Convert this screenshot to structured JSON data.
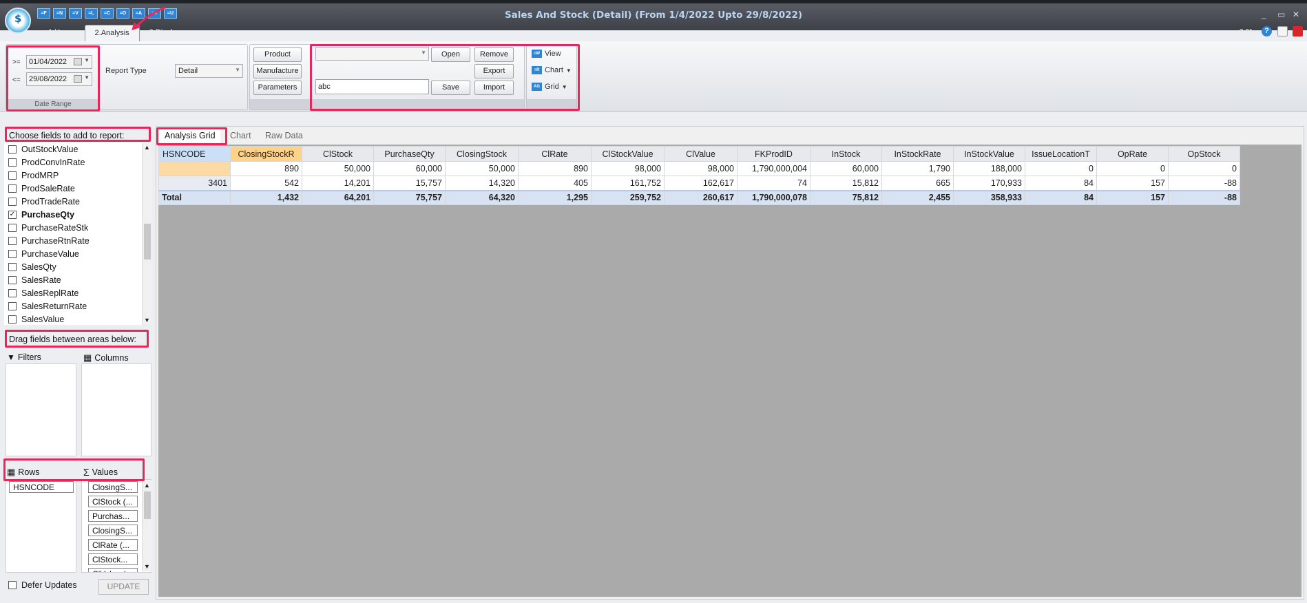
{
  "window": {
    "title": "Sales And Stock (Detail)  (From 1/4/2022 Upto 29/8/2022)",
    "version": "3.31",
    "logo_text": "$",
    "qat_buttons": [
      "=F",
      "=N",
      "=V",
      "=L",
      "=C",
      "=O",
      "=A",
      "=T",
      "=U"
    ],
    "controls": [
      "_",
      "▭",
      "✕"
    ]
  },
  "tabs": [
    {
      "label": "1.Home"
    },
    {
      "label": "2.Analysis"
    },
    {
      "label": "3.Display"
    }
  ],
  "ribbon": {
    "date_range": {
      "from_op": ">=",
      "from_value": "01/04/2022",
      "to_op": "<=",
      "to_value": "29/08/2022",
      "group_label": "Date Range"
    },
    "report_type": {
      "label": "Report Type",
      "value": "Detail"
    },
    "filter_buttons": [
      "Product",
      "Manufacture",
      "Parameters"
    ],
    "layout": {
      "combo_value": "",
      "name_value": "abc",
      "open_label": "Open",
      "remove_label": "Remove",
      "export_label": "Export",
      "save_label": "Save",
      "import_label": "Import"
    },
    "view_buttons": [
      {
        "label": "View",
        "icon": "view-icon"
      },
      {
        "label": "Chart",
        "icon": "chart-icon"
      },
      {
        "label": "Grid",
        "icon": "grid-icon"
      }
    ]
  },
  "field_list": {
    "header": "Choose fields to add to report:",
    "items": [
      {
        "label": "OutStockValue",
        "checked": false
      },
      {
        "label": "ProdConvInRate",
        "checked": false
      },
      {
        "label": "ProdMRP",
        "checked": false
      },
      {
        "label": "ProdSaleRate",
        "checked": false
      },
      {
        "label": "ProdTradeRate",
        "checked": false
      },
      {
        "label": "PurchaseQty",
        "checked": true
      },
      {
        "label": "PurchaseRateStk",
        "checked": false
      },
      {
        "label": "PurchaseRtnRate",
        "checked": false
      },
      {
        "label": "PurchaseValue",
        "checked": false
      },
      {
        "label": "SalesQty",
        "checked": false
      },
      {
        "label": "SalesRate",
        "checked": false
      },
      {
        "label": "SalesReplRate",
        "checked": false
      },
      {
        "label": "SalesReturnRate",
        "checked": false
      },
      {
        "label": "SalesValue",
        "checked": false
      }
    ]
  },
  "areas": {
    "header": "Drag fields between areas below:",
    "filters_label": "Filters",
    "columns_label": "Columns",
    "rows_label": "Rows",
    "values_label": "Values",
    "rows_items": [
      "HSNCODE"
    ],
    "values_items": [
      "ClosingS...",
      "ClStock (...",
      "Purchas...",
      "ClosingS...",
      "ClRate (...",
      "ClStock...",
      "ClValue (..."
    ]
  },
  "defer": {
    "label": "Defer Updates",
    "checked": false,
    "update_label": "UPDATE"
  },
  "grid_tabs": [
    {
      "label": "Analysis Grid"
    },
    {
      "label": "Chart"
    },
    {
      "label": "Raw Data"
    }
  ],
  "grid": {
    "row_header": "HSNCODE",
    "columns": [
      "ClosingStockR",
      "ClStock",
      "PurchaseQty",
      "ClosingStock",
      "ClRate",
      "ClStockValue",
      "ClValue",
      "FKProdID",
      "InStock",
      "InStockRate",
      "InStockValue",
      "IssueLocationT",
      "OpRate",
      "OpStock"
    ],
    "rows": [
      {
        "label": "",
        "values": [
          "890",
          "50,000",
          "60,000",
          "50,000",
          "890",
          "98,000",
          "98,000",
          "1,790,000,004",
          "60,000",
          "1,790",
          "188,000",
          "0",
          "0",
          "0"
        ]
      },
      {
        "label": "3401",
        "values": [
          "542",
          "14,201",
          "15,757",
          "14,320",
          "405",
          "161,752",
          "162,617",
          "74",
          "15,812",
          "665",
          "170,933",
          "84",
          "157",
          "-88"
        ]
      }
    ],
    "total": {
      "label": "Total",
      "values": [
        "1,432",
        "64,201",
        "75,757",
        "64,320",
        "1,295",
        "259,752",
        "260,617",
        "1,790,000,078",
        "75,812",
        "2,455",
        "358,933",
        "84",
        "157",
        "-88"
      ]
    }
  }
}
